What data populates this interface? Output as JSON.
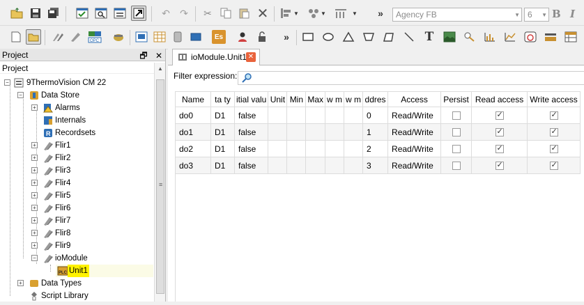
{
  "toolbar": {
    "font_name": "Agency FB",
    "font_size": "6",
    "bold_label": "B",
    "italic_label": "I",
    "overflow_label": "»",
    "es_label": "Es",
    "text_tool_label": "T"
  },
  "left_panel": {
    "title": "Project",
    "float_label": "🗗",
    "close_label": "✕",
    "tree_header": "Project",
    "tree": {
      "root": "9ThermoVision CM 22",
      "data_store": "Data Store",
      "alarms": "Alarms",
      "internals": "Internals",
      "recordsets": "Recordsets",
      "flirs": [
        "Flir1",
        "Flir2",
        "Flir3",
        "Flir4",
        "Flir5",
        "Flir6",
        "Flir7",
        "Flir8",
        "Flir9"
      ],
      "iomodule": "ioModule",
      "unit1": "Unit1",
      "data_types": "Data Types",
      "script_library": "Script Library"
    }
  },
  "editor": {
    "tab_label": "ioModule.Unit1",
    "filter_label": "Filter expression:",
    "columns": [
      "Name",
      "ta ty",
      "itial valu",
      "Unit",
      "Min",
      "Max",
      "w m",
      "w m",
      "ddres",
      "Access",
      "Persist",
      "Read access",
      "Write access"
    ],
    "rows": [
      {
        "name": "do0",
        "type": "D1",
        "initial": "false",
        "address": "0",
        "access": "Read/Write",
        "persist": false,
        "read": true,
        "write": true
      },
      {
        "name": "do1",
        "type": "D1",
        "initial": "false",
        "address": "1",
        "access": "Read/Write",
        "persist": false,
        "read": true,
        "write": true
      },
      {
        "name": "do2",
        "type": "D1",
        "initial": "false",
        "address": "2",
        "access": "Read/Write",
        "persist": false,
        "read": true,
        "write": true
      },
      {
        "name": "do3",
        "type": "D1",
        "initial": "false",
        "address": "3",
        "access": "Read/Write",
        "persist": false,
        "read": true,
        "write": true
      }
    ]
  },
  "colors": {
    "highlight": "#fff200",
    "close_tab": "#e9633c",
    "accent_blue": "#2f6fb5"
  }
}
